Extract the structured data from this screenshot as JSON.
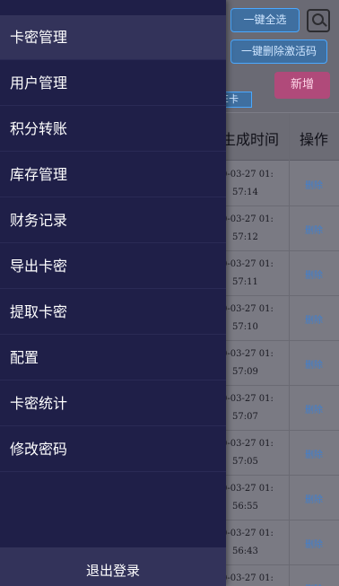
{
  "background": {
    "select_all_label": "一键全选",
    "delete_codes_label": "一键删除激活码",
    "add_label": "新增",
    "card_tag": "E卡",
    "table": {
      "headers": [
        "生成时间",
        "操作"
      ],
      "rows": [
        {
          "date": "0-03-27 01:",
          "time": "57:14",
          "action": "删除"
        },
        {
          "date": "0-03-27 01:",
          "time": "57:12",
          "action": "删除"
        },
        {
          "date": "0-03-27 01:",
          "time": "57:11",
          "action": "删除"
        },
        {
          "date": "0-03-27 01:",
          "time": "57:10",
          "action": "删除"
        },
        {
          "date": "0-03-27 01:",
          "time": "57:09",
          "action": "删除"
        },
        {
          "date": "0-03-27 01:",
          "time": "57:07",
          "action": "删除"
        },
        {
          "date": "0-03-27 01:",
          "time": "57:05",
          "action": "删除"
        },
        {
          "date": "0-03-27 01:",
          "time": "56:55",
          "action": "删除"
        },
        {
          "date": "0-03-27 01:",
          "time": "56:43",
          "action": "删除"
        },
        {
          "date": "0-03-27 01:",
          "time": "",
          "action": "删除"
        }
      ]
    }
  },
  "drawer": {
    "items": [
      {
        "label": "卡密管理",
        "active": true
      },
      {
        "label": "用户管理",
        "active": false
      },
      {
        "label": "积分转账",
        "active": false
      },
      {
        "label": "库存管理",
        "active": false
      },
      {
        "label": "财务记录",
        "active": false
      },
      {
        "label": "导出卡密",
        "active": false
      },
      {
        "label": "提取卡密",
        "active": false
      },
      {
        "label": "配置",
        "active": false
      },
      {
        "label": "卡密统计",
        "active": false
      },
      {
        "label": "修改密码",
        "active": false
      }
    ],
    "logout_label": "退出登录"
  },
  "colors": {
    "drawer_bg": "#1f1f48",
    "drawer_active": "#33335a",
    "accent_blue": "#4aa8ff",
    "add_button": "#b04a7a"
  }
}
